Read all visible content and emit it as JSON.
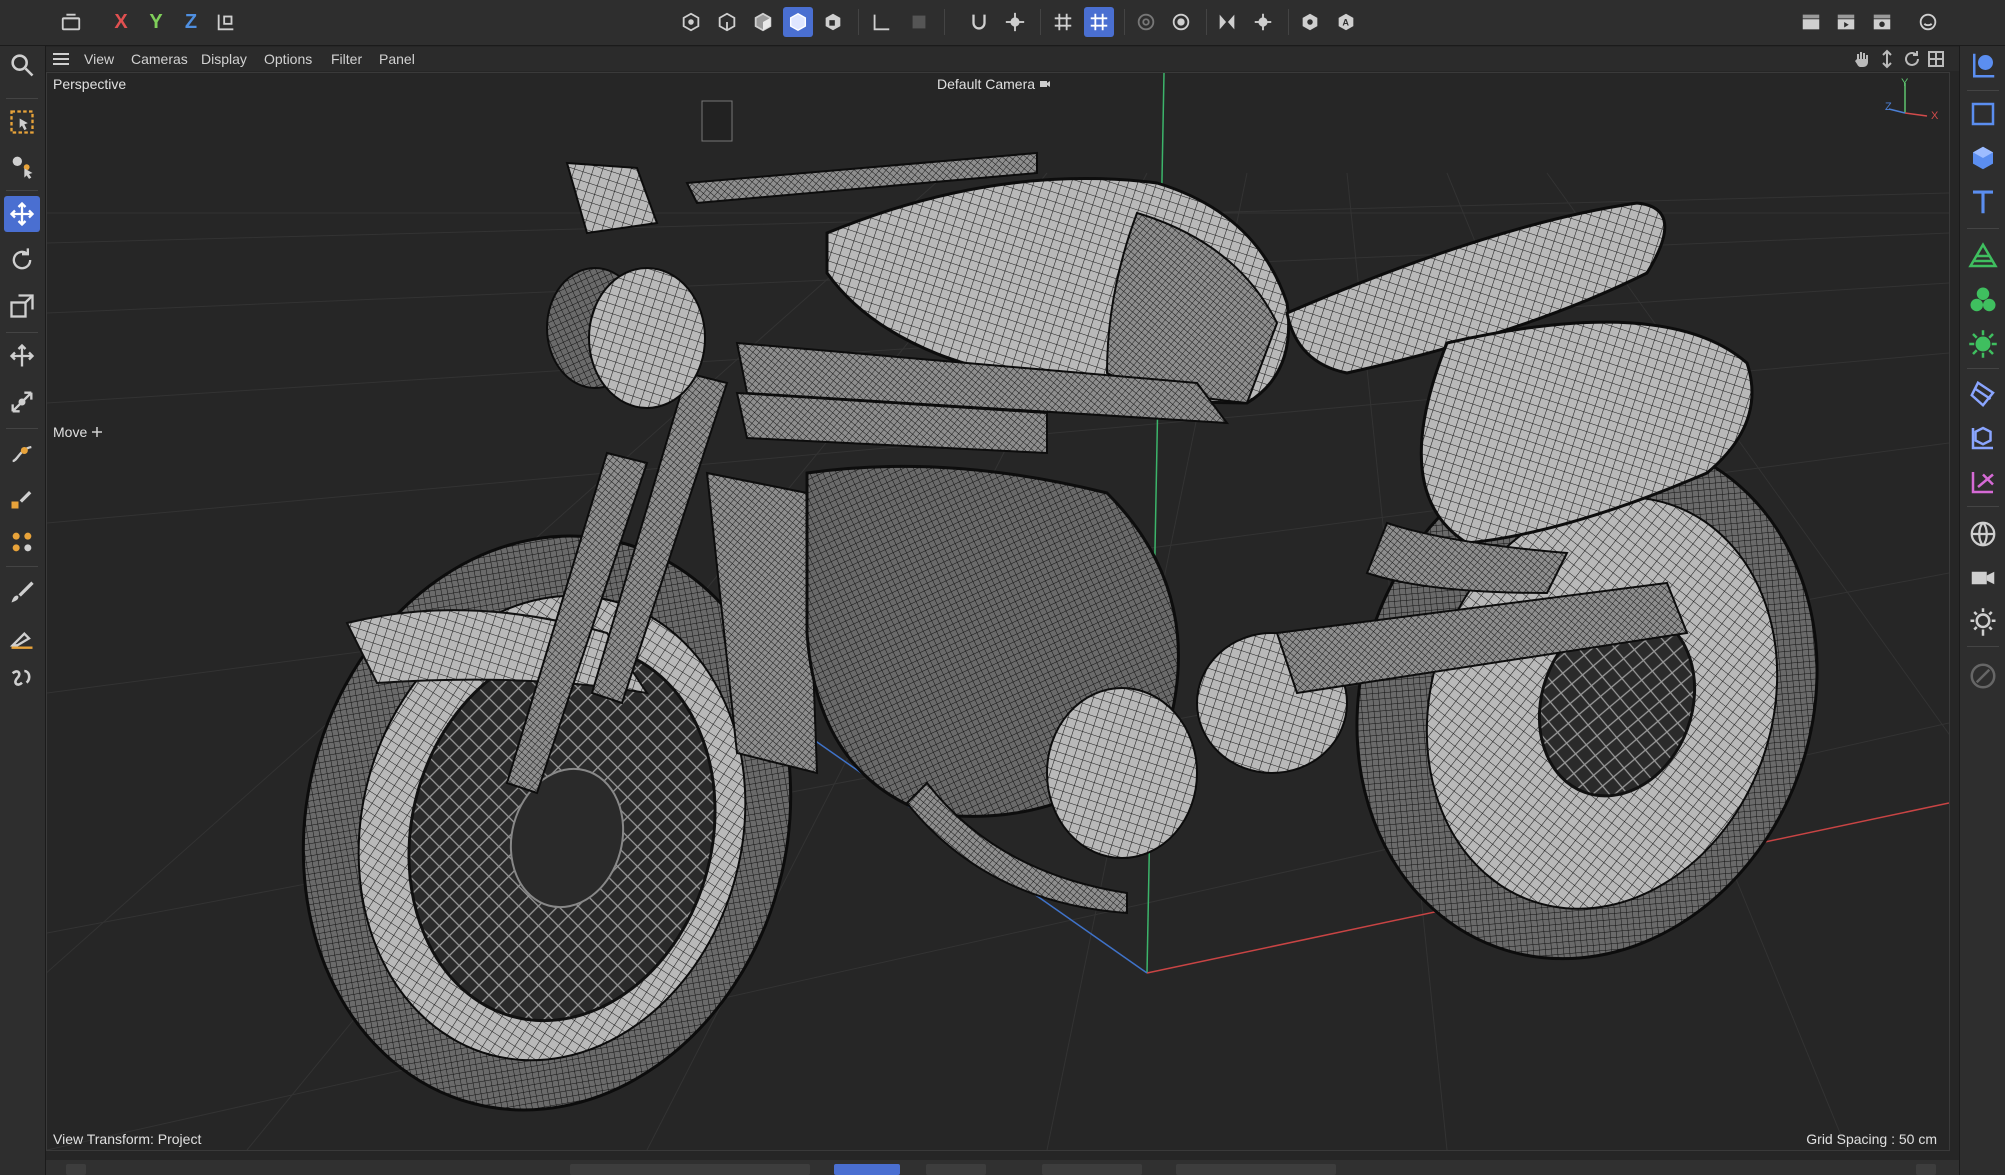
{
  "toolbar": {
    "axis_x": "X",
    "axis_y": "Y",
    "axis_z": "Z",
    "colors": {
      "x": "#e05050",
      "y": "#7fcf5a",
      "z": "#4f8fe0",
      "accent": "#4a6fd1"
    }
  },
  "menu": {
    "view": "View",
    "cameras": "Cameras",
    "display": "Display",
    "options": "Options",
    "filter": "Filter",
    "panel": "Panel"
  },
  "viewport": {
    "name": "Perspective",
    "camera": "Default Camera",
    "tool_hud": "Move",
    "view_transform": "View Transform: Project",
    "grid_spacing": "Grid Spacing : 50 cm",
    "axis_x": "X",
    "axis_y": "Y",
    "axis_z": "Z"
  },
  "icons": {
    "left": [
      "selection-icon",
      "live-select-icon",
      "move-icon",
      "rotate-icon",
      "scale-icon",
      "transfer-icon",
      "snap-scale-icon",
      "spline-pen-icon",
      "spline-paint-icon",
      "sculpt-icon",
      "brush-icon",
      "knife-icon",
      "polygon-pen-icon"
    ],
    "right": [
      "object-manager-icon",
      "null-icon",
      "cube-icon",
      "text-icon",
      "spline-icon",
      "generator-icon",
      "deformer-icon",
      "field-icon",
      "tag-icon",
      "camera-icon",
      "environment-icon",
      "light-icon",
      "render-icon",
      "edit-disabled-icon"
    ]
  }
}
